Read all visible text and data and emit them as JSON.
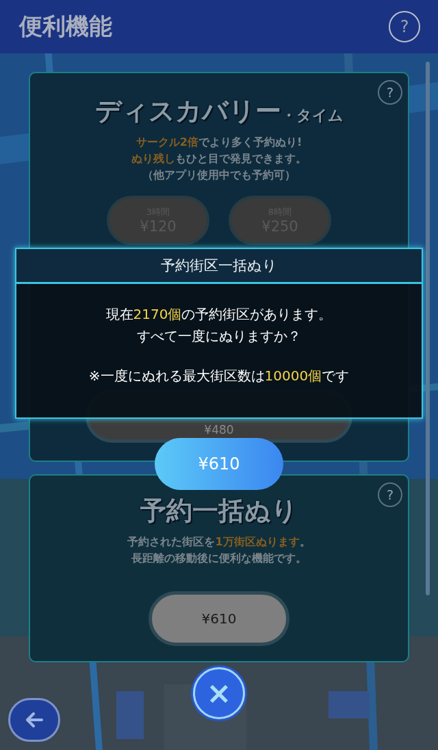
{
  "header": {
    "title": "便利機能",
    "help": "?"
  },
  "cards": [
    {
      "kind": "plans",
      "help": "?",
      "title": "ディスカバリー",
      "title_suffix": "・タイム",
      "lines": [
        "**サークル2倍**でより多く予約ぬり!",
        "**ぬり残し**もひと目で発見できます。",
        "（他アプリ使用中でも予約可）"
      ],
      "plans": [
        {
          "duration": "3時間",
          "price": "¥120"
        },
        {
          "duration": "8時間",
          "price": "¥250"
        }
      ]
    },
    {
      "kind": "hidden",
      "price": "¥480"
    },
    {
      "kind": "single",
      "help": "?",
      "title": "予約一括ぬり",
      "lines": [
        "予約された街区を**1万街区ぬります**。",
        "長距離の移動後に便利な機能です。"
      ],
      "price": "¥610"
    }
  ],
  "dialog": {
    "title": "予約街区一括ぬり",
    "lines": [
      "現在**2170個**の予約街区があります。",
      "すべて一度にぬりますか？"
    ],
    "note": "※一度にぬれる最大街区数は**10000個**です",
    "confirm": "¥610"
  },
  "close": "×"
}
